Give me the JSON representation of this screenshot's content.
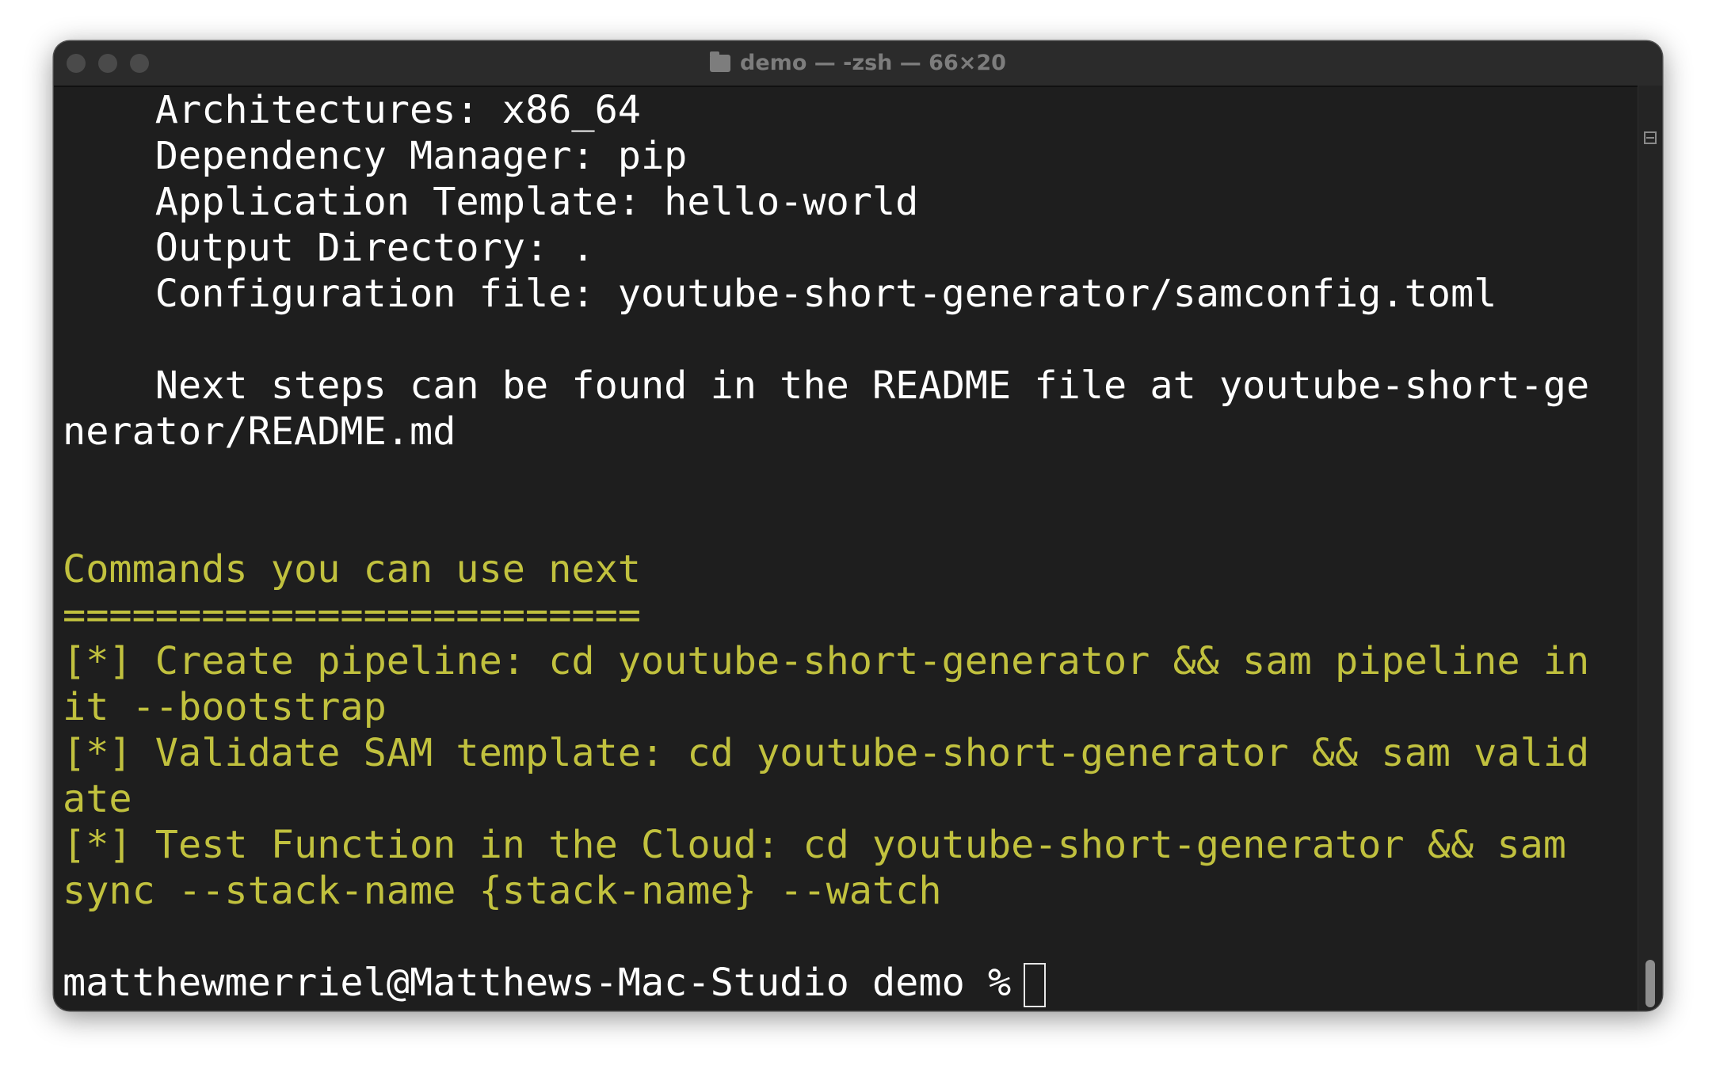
{
  "window": {
    "title": "demo — -zsh — 66×20"
  },
  "terminal": {
    "lines": [
      {
        "text": "    Architectures: x86_64",
        "color": "white"
      },
      {
        "text": "    Dependency Manager: pip",
        "color": "white"
      },
      {
        "text": "    Application Template: hello-world",
        "color": "white"
      },
      {
        "text": "    Output Directory: .",
        "color": "white"
      },
      {
        "text": "    Configuration file: youtube-short-generator/samconfig.toml",
        "color": "white"
      },
      {
        "text": "",
        "color": "white"
      },
      {
        "text": "    Next steps can be found in the README file at youtube-short-ge",
        "color": "white"
      },
      {
        "text": "nerator/README.md",
        "color": "white"
      },
      {
        "text": "",
        "color": "white"
      },
      {
        "text": "",
        "color": "white"
      },
      {
        "text": "Commands you can use next",
        "color": "yellow"
      },
      {
        "text": "=========================",
        "color": "yellow"
      },
      {
        "text": "[*] Create pipeline: cd youtube-short-generator && sam pipeline in",
        "color": "yellow"
      },
      {
        "text": "it --bootstrap",
        "color": "yellow"
      },
      {
        "text": "[*] Validate SAM template: cd youtube-short-generator && sam valid",
        "color": "yellow"
      },
      {
        "text": "ate",
        "color": "yellow"
      },
      {
        "text": "[*] Test Function in the Cloud: cd youtube-short-generator && sam ",
        "color": "yellow"
      },
      {
        "text": "sync --stack-name {stack-name} --watch",
        "color": "yellow"
      },
      {
        "text": "",
        "color": "white"
      }
    ],
    "prompt": "matthewmerriel@Matthews-Mac-Studio demo %"
  },
  "colors": {
    "background": "#1e1e1e",
    "text": "#ffffff",
    "yellow": "#c1c13e",
    "titlebar": "#2b2b2b"
  }
}
